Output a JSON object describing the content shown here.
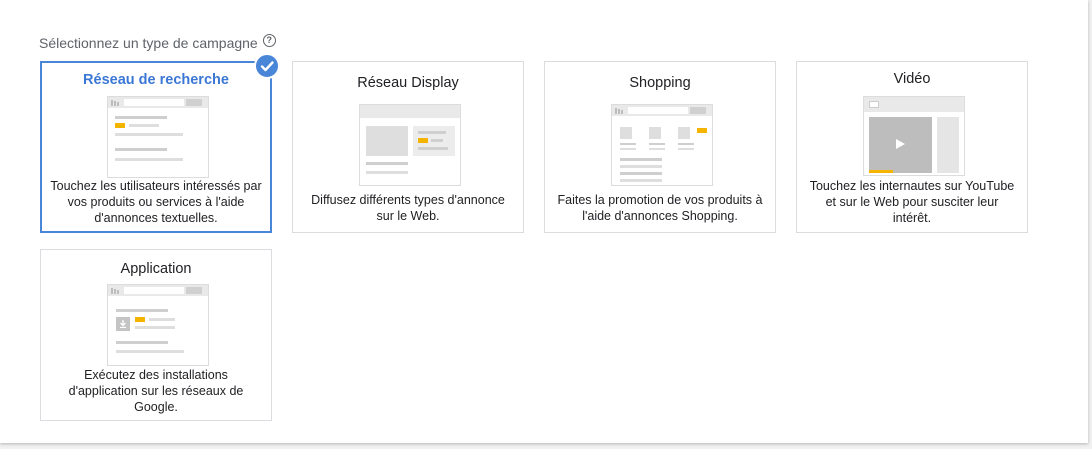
{
  "section": {
    "heading": "Sélectionnez un type de campagne",
    "help_icon": "question-circle-icon"
  },
  "campaign_types": [
    {
      "title": "Réseau de recherche",
      "description": "Touchez les utilisateurs intéressés par vos produits ou services à l'aide d'annonces textuelles.",
      "selected": true
    },
    {
      "title": "Réseau Display",
      "description": "Diffusez différents types d'annonce sur le Web.",
      "selected": false
    },
    {
      "title": "Shopping",
      "description": "Faites la promotion de vos produits à l'aide d'annonces Shopping.",
      "selected": false
    },
    {
      "title": "Vidéo",
      "description": "Touchez les internautes sur YouTube et sur le Web pour susciter leur intérêt.",
      "selected": false
    },
    {
      "title": "Application",
      "description": "Exécutez des installations d'application sur les réseaux de Google.",
      "selected": false
    }
  ],
  "colors": {
    "accent": "#4a86d7",
    "highlight": "#f4b400",
    "border": "#dadce0"
  }
}
